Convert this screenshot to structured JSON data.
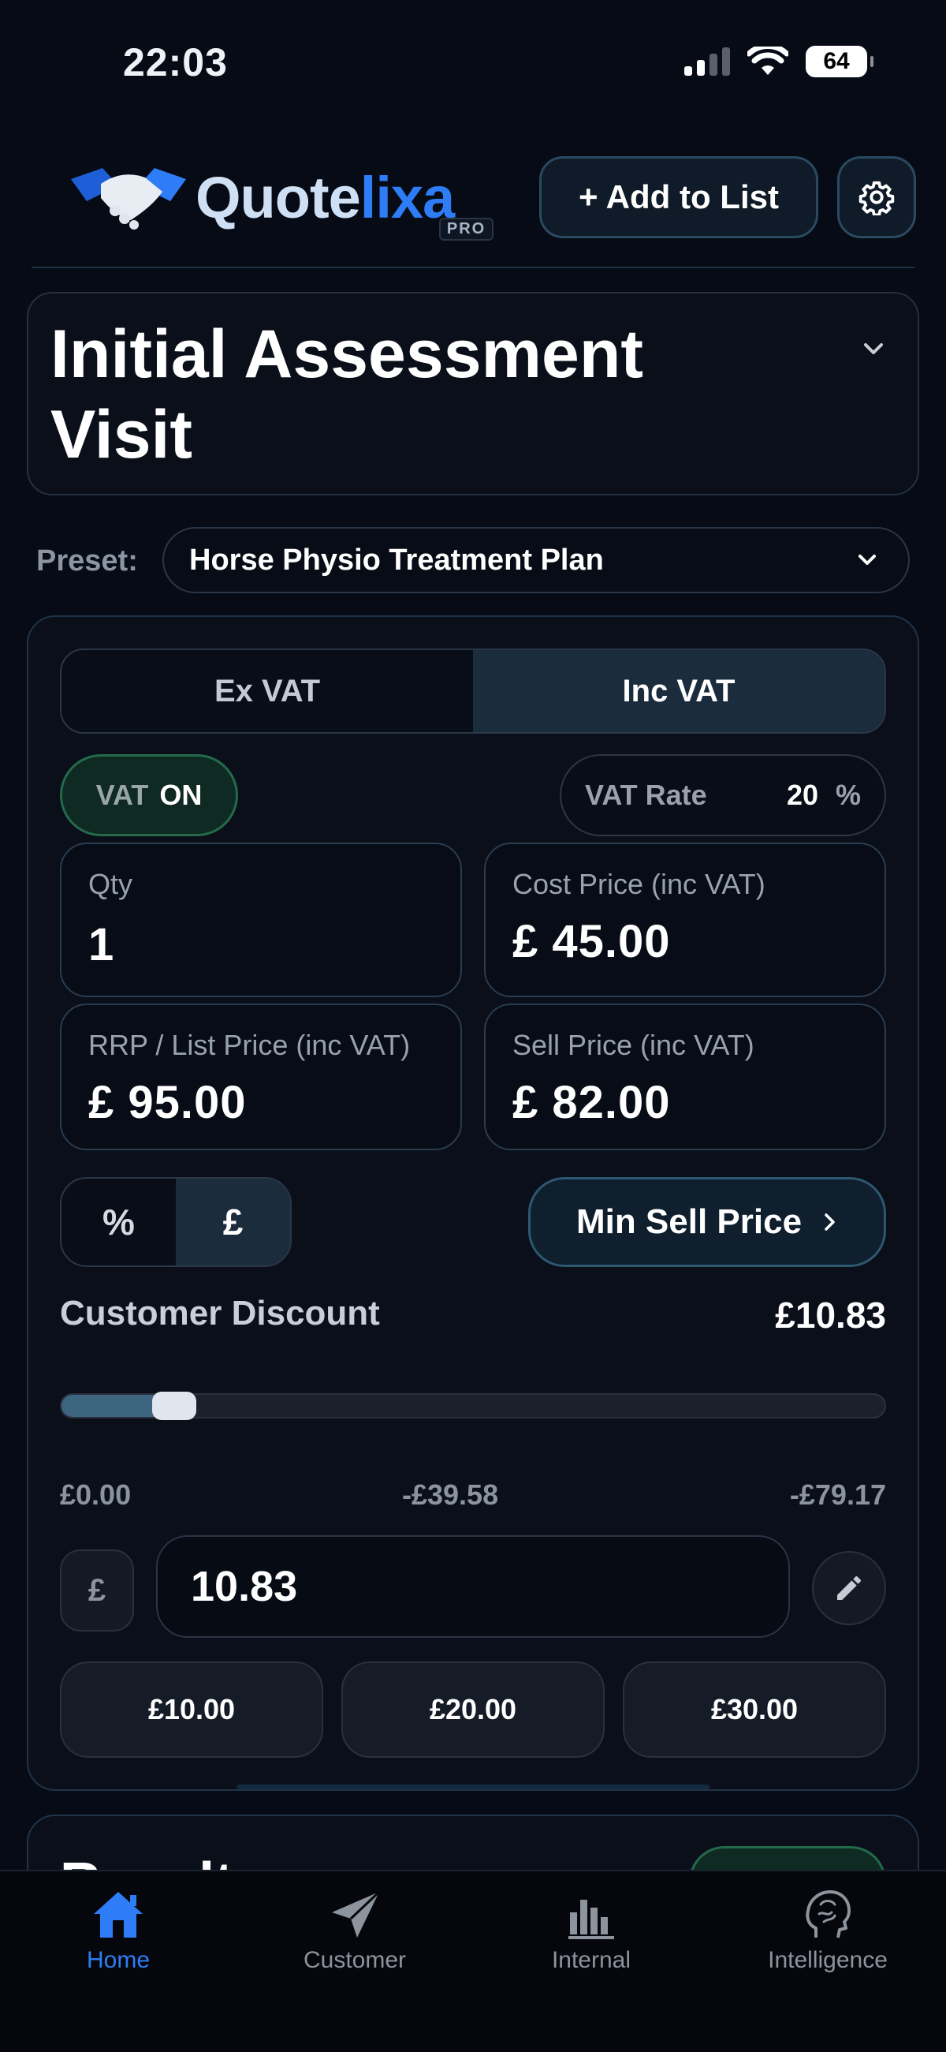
{
  "status_bar": {
    "time": "22:03",
    "battery": "64"
  },
  "header": {
    "logo_text_main": "Quote",
    "logo_text_accent": "lixa",
    "logo_badge": "PRO",
    "add_button_label": "+ Add to List"
  },
  "item": {
    "title": "Initial Assessment Visit"
  },
  "preset": {
    "label": "Preset:",
    "value": "Horse Physio Treatment Plan"
  },
  "vat_mode": {
    "options": [
      "Ex VAT",
      "Inc VAT"
    ],
    "selected": "Inc VAT"
  },
  "vat_switch": {
    "label": "VAT",
    "state": "ON"
  },
  "vat_rate": {
    "label": "VAT Rate",
    "value": "20",
    "unit": "%"
  },
  "fields": {
    "qty": {
      "label": "Qty",
      "value": "1"
    },
    "cost": {
      "label": "Cost Price (inc VAT)",
      "value": "£ 45.00"
    },
    "rrp": {
      "label": "RRP / List Price (inc VAT)",
      "value": "£ 95.00"
    },
    "sell": {
      "label": "Sell Price (inc VAT)",
      "value": "£ 82.00"
    }
  },
  "discount_mode": {
    "options": [
      "%",
      "£"
    ],
    "selected": "£"
  },
  "min_sell_button": {
    "label": "Min Sell Price"
  },
  "discount": {
    "label": "Customer Discount",
    "value": "£10.83",
    "slider_fraction": 0.137,
    "tick_min": "£0.00",
    "tick_mid": "-£39.58",
    "tick_max": "-£79.17",
    "currency_symbol": "£",
    "input_value": "10.83",
    "quick_amounts": [
      "£10.00",
      "£20.00",
      "£30.00"
    ]
  },
  "results": {
    "title": "Results"
  },
  "nav": {
    "items": [
      {
        "label": "Home",
        "icon": "home-icon",
        "active": true
      },
      {
        "label": "Customer",
        "icon": "send-icon",
        "active": false
      },
      {
        "label": "Internal",
        "icon": "bar-chart-icon",
        "active": false
      },
      {
        "label": "Intelligence",
        "icon": "brain-icon",
        "active": false
      }
    ]
  },
  "colors": {
    "accent": "#2f7df6",
    "success": "#236a4a",
    "background": "#060b16"
  }
}
